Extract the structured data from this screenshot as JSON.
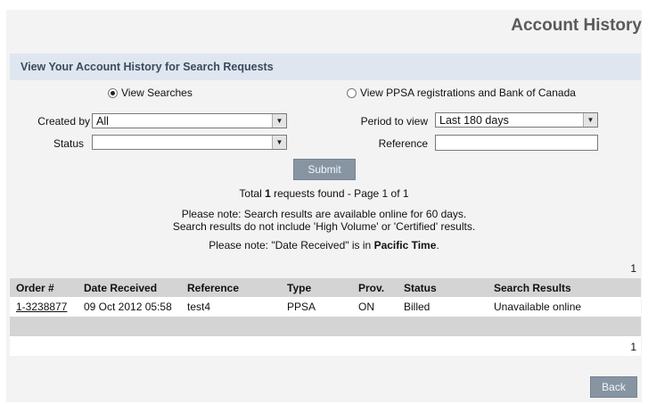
{
  "header": {
    "title": "Account History"
  },
  "section": {
    "title": "View Your Account History for Search Requests"
  },
  "view_options": {
    "searches_label": "View Searches",
    "ppsa_label": "View PPSA registrations and Bank of Canada"
  },
  "filters": {
    "created_by_label": "Created by",
    "created_by_value": "All",
    "status_label": "Status",
    "status_value": "",
    "period_label": "Period to view",
    "period_value": "Last 180 days",
    "reference_label": "Reference",
    "reference_value": ""
  },
  "submit_label": "Submit",
  "summary": {
    "prefix": "Total ",
    "count": "1",
    "suffix": " requests found - Page 1 of 1"
  },
  "notes": {
    "line1": "Please note: Search results are available online for 60 days.",
    "line2": "Search results do not include 'High Volume' or 'Certified' results.",
    "tz_prefix": "Please note: \"Date Received\" is in ",
    "tz_bold": "Pacific Time",
    "tz_suffix": "."
  },
  "pagination": {
    "top": "1",
    "bottom": "1"
  },
  "table": {
    "headers": [
      "Order #",
      "Date Received",
      "Reference",
      "Type",
      "Prov.",
      "Status",
      "Search Results"
    ],
    "rows": [
      [
        "1-3238877",
        "09 Oct 2012 05:58",
        "test4",
        "PPSA",
        "ON",
        "Billed",
        "Unavailable online"
      ]
    ]
  },
  "back_label": "Back"
}
